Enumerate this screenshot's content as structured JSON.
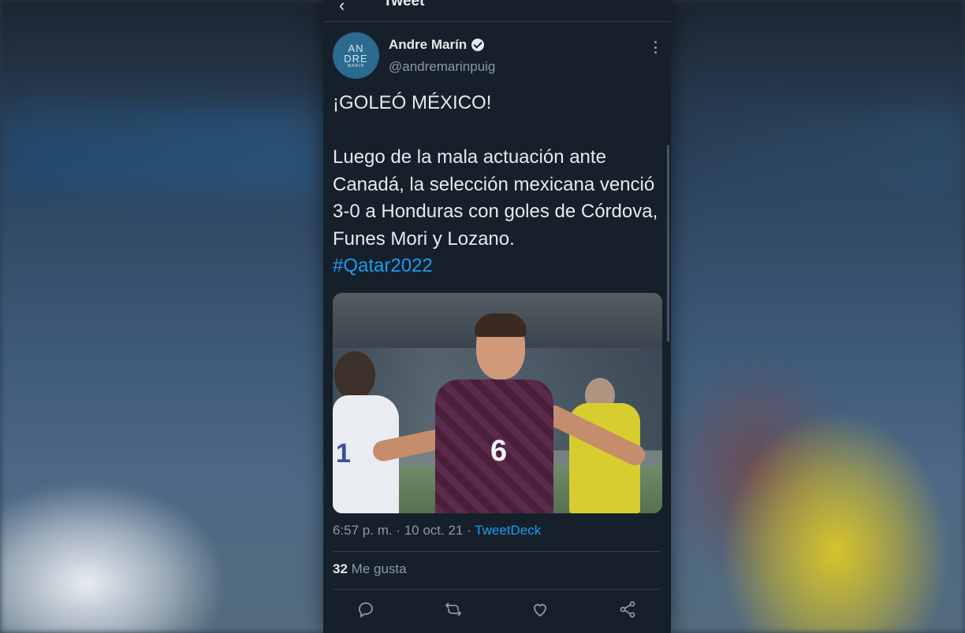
{
  "window": {
    "title": "Tweet"
  },
  "author": {
    "avatar_lines": [
      "AN",
      "DRE",
      "MARIN"
    ],
    "name": "Andre Marín",
    "handle": "@andremarinpuig",
    "verified": true
  },
  "tweet": {
    "text": "¡GOLEÓ MÉXICO!\n\nLuego de la mala actuación ante Canadá, la selección mexicana venció 3-0 a Honduras con goles de Córdova, Funes Mori y Lozano.",
    "hashtag": "#Qatar2022",
    "photo": {
      "jersey_number": "6",
      "opponent_number": "1"
    },
    "time": "6:57 p. m. · 10 oct. 21 · ",
    "source": "TweetDeck"
  },
  "engagement": {
    "likes_count": "32",
    "likes_label": "Me gusta"
  },
  "actions": {
    "reply": "reply-icon",
    "retweet": "retweet-icon",
    "like": "heart-icon",
    "share": "share-icon"
  },
  "colors": {
    "background": "#15202b",
    "accent": "#1d9bf0",
    "text": "#e7e9ea",
    "muted": "#8b98a5"
  }
}
